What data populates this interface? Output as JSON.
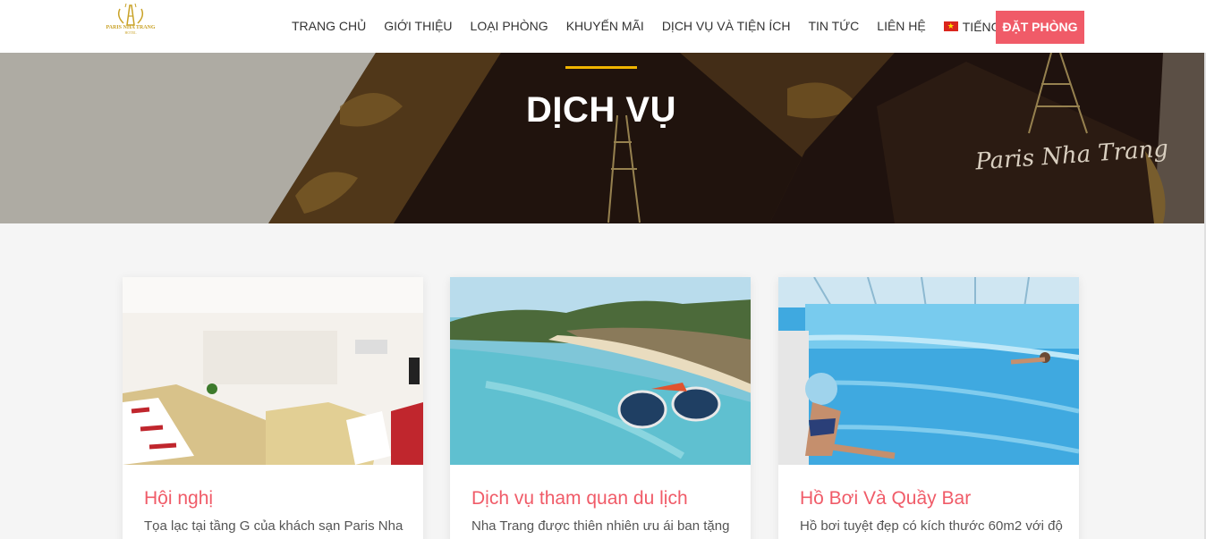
{
  "header": {
    "logo": {
      "text": "PARIS NHA TRANG",
      "subtext": "HOTEL"
    },
    "nav": [
      {
        "label": "TRANG CHỦ"
      },
      {
        "label": "GIỚI THIỆU"
      },
      {
        "label": "LOẠI PHÒNG"
      },
      {
        "label": "KHUYẾN MÃI"
      },
      {
        "label": "DỊCH VỤ VÀ TIỆN ÍCH"
      },
      {
        "label": "TIN TỨC"
      },
      {
        "label": "LIÊN HỆ"
      }
    ],
    "language": {
      "label": "TIẾNG VIỆT",
      "icon": "vietnam-flag-icon"
    },
    "book_button": "ĐẶT PHÒNG"
  },
  "hero": {
    "title": "DỊCH VỤ",
    "script_text": "Paris Nha Trang"
  },
  "cards": [
    {
      "title": "Hội nghị",
      "text": "Tọa lạc tại tầng G của khách sạn Paris Nha",
      "image": "conference-room-photo"
    },
    {
      "title": "Dịch vụ tham quan du lịch",
      "text": "Nha Trang được thiên nhiên ưu ái ban tặng",
      "image": "beach-tour-photo"
    },
    {
      "title": "Hồ Bơi Và Quầy Bar",
      "text": "Hồ bơi tuyệt đẹp có kích thước 60m2 với độ",
      "image": "swimming-pool-photo"
    }
  ],
  "colors": {
    "accent": "#f05b68",
    "gold": "#f0b400",
    "logo_gold": "#c9a227"
  }
}
